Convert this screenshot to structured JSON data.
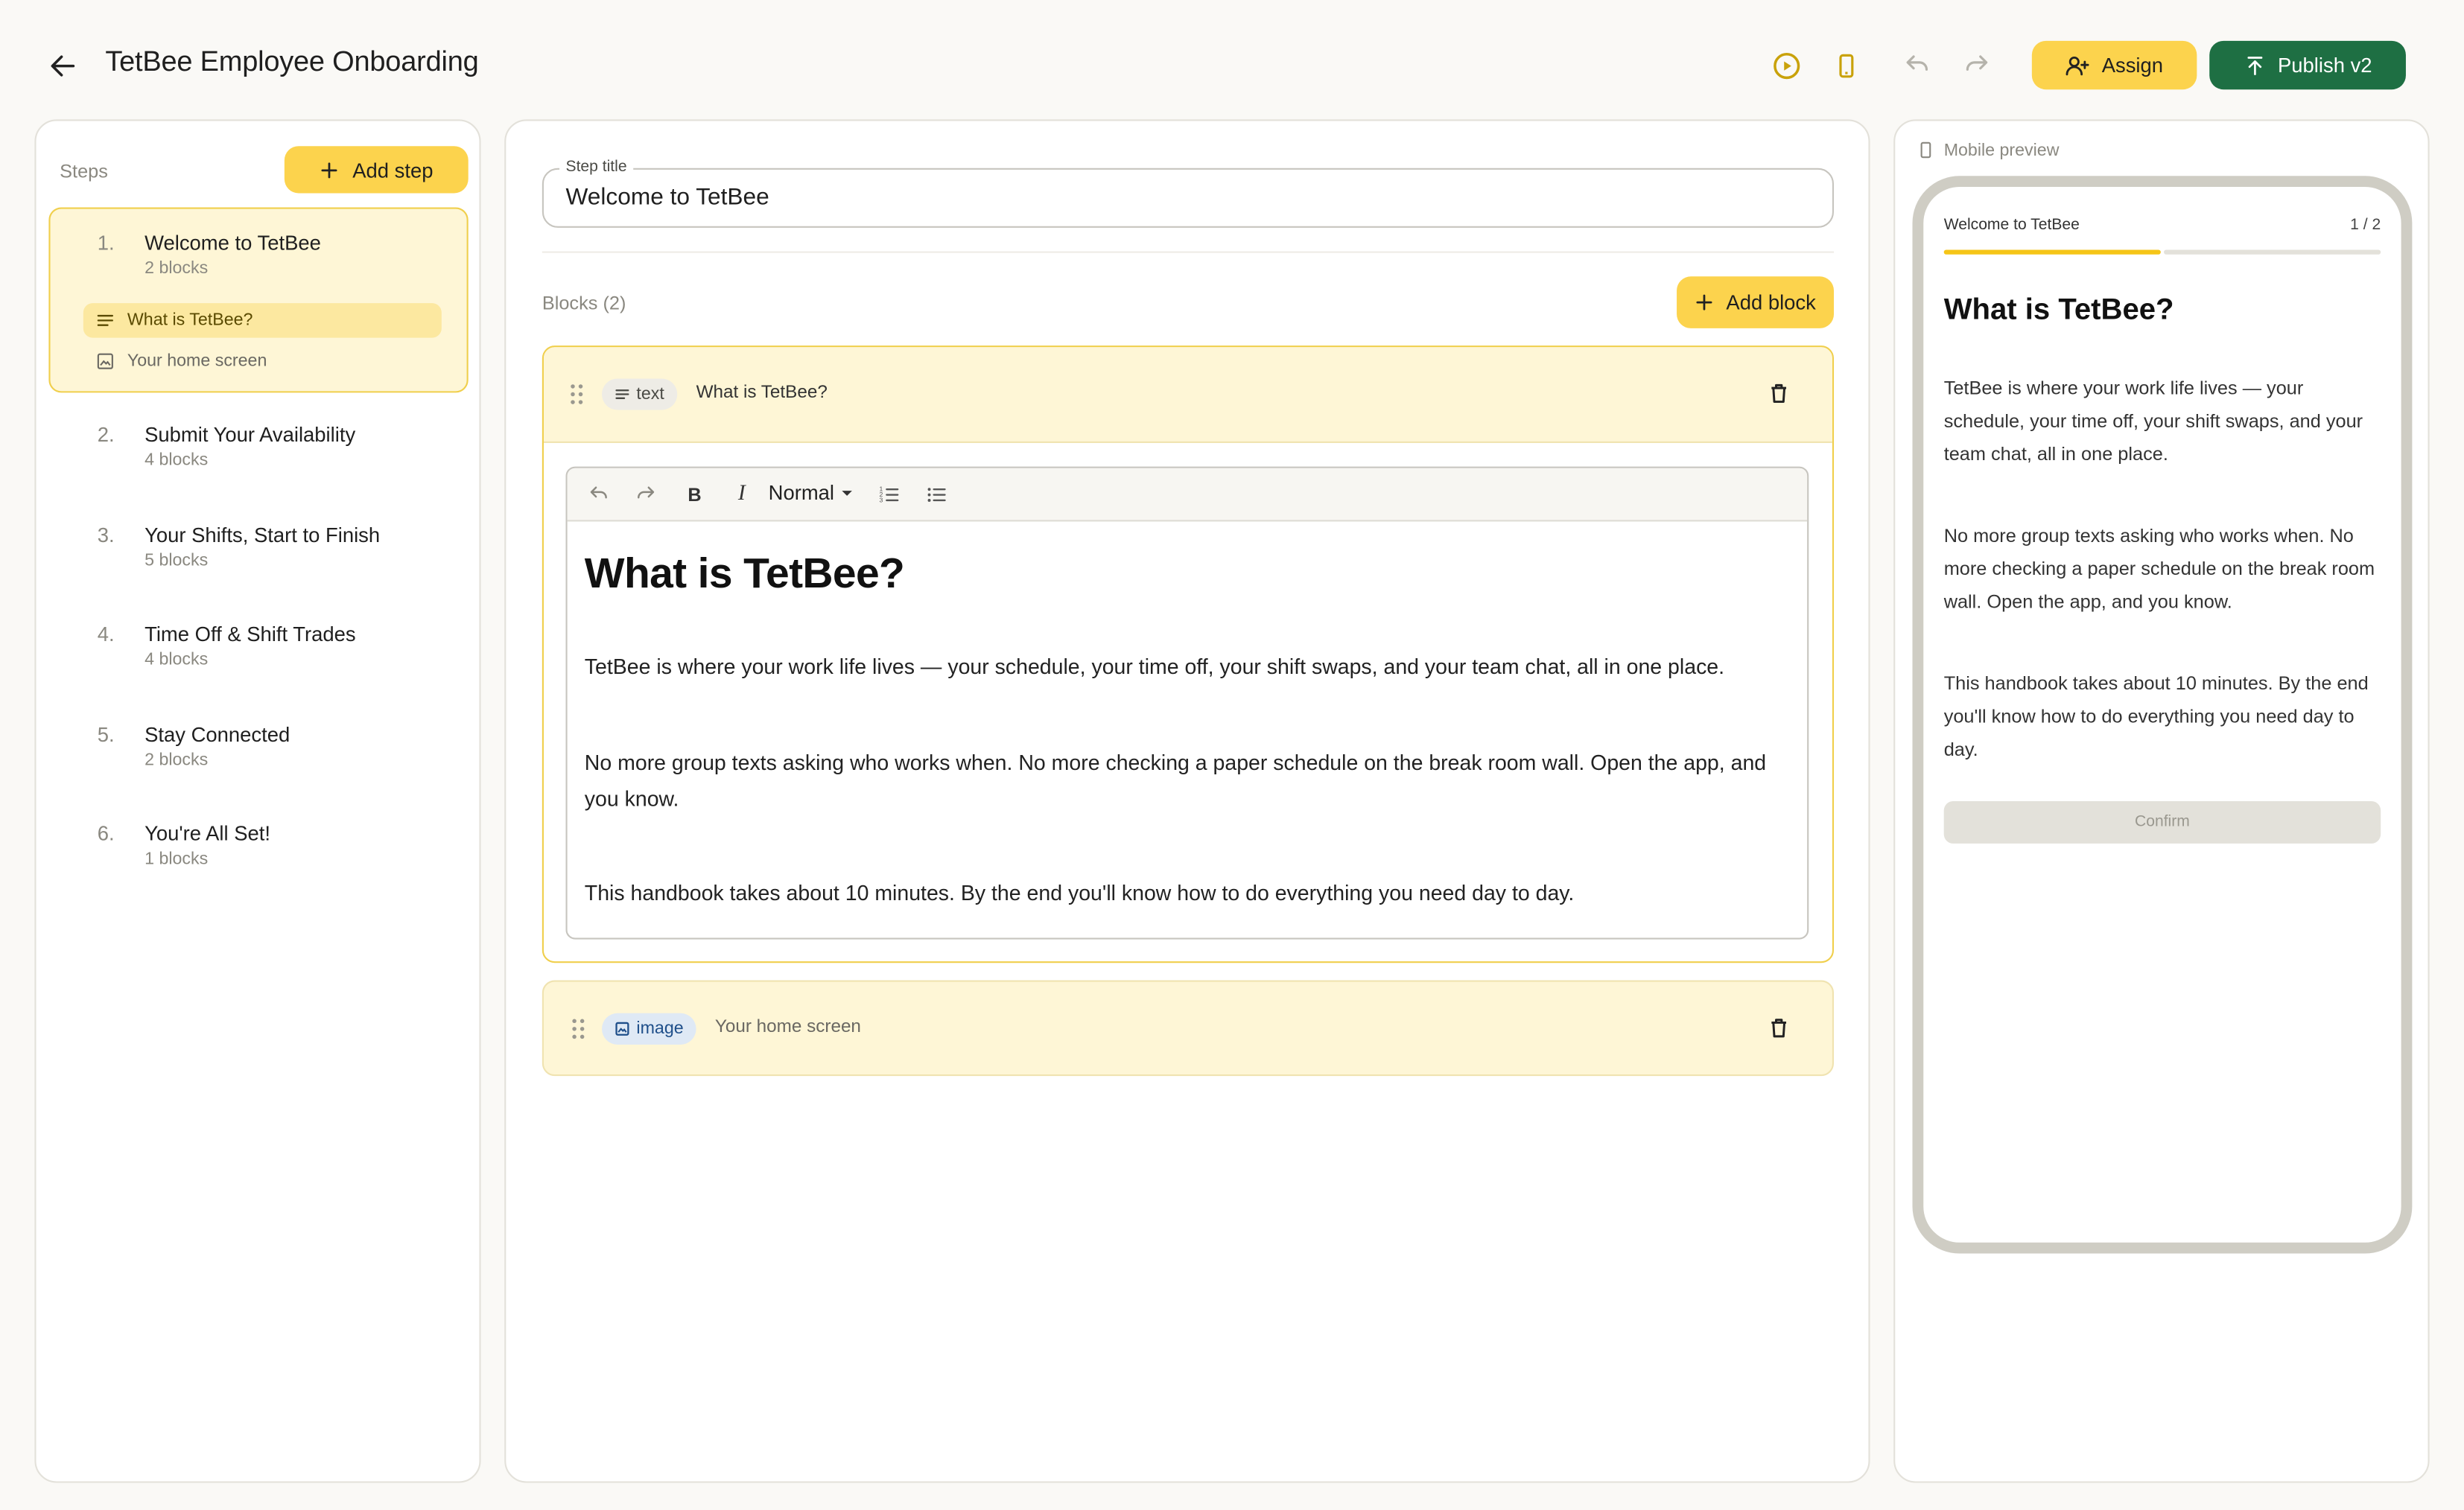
{
  "header": {
    "title": "TetBee Employee Onboarding",
    "assign_label": "Assign",
    "publish_label": "Publish v2",
    "icons": [
      "back-arrow-icon",
      "play-circle-icon",
      "mobile-phone-icon",
      "undo-icon",
      "redo-icon"
    ],
    "accent_color": "#fcd34d",
    "publish_color": "#1e6f43"
  },
  "steps_panel": {
    "label": "Steps",
    "add_step_label": "Add step",
    "steps": [
      {
        "num": "1.",
        "title": "Welcome to TetBee",
        "sub": "2 blocks",
        "blocks": [
          {
            "label": "What is TetBee?",
            "icon": "text-lines-icon"
          },
          {
            "label": "Your home screen",
            "icon": "image-icon"
          }
        ]
      },
      {
        "num": "2.",
        "title": "Submit Your Availability",
        "sub": "4 blocks"
      },
      {
        "num": "3.",
        "title": "Your Shifts, Start to Finish",
        "sub": "5 blocks"
      },
      {
        "num": "4.",
        "title": "Time Off & Shift Trades",
        "sub": "4 blocks"
      },
      {
        "num": "5.",
        "title": "Stay Connected",
        "sub": "2 blocks"
      },
      {
        "num": "6.",
        "title": "You're All Set!",
        "sub": "1 blocks"
      }
    ]
  },
  "editor": {
    "step_title_label": "Step title",
    "step_title_value": "Welcome to TetBee",
    "blocks_label": "Blocks (2)",
    "add_block_label": "Add block",
    "blocks": [
      {
        "type": "text",
        "title": "What is TetBee?"
      },
      {
        "type": "image",
        "title": "Your home screen"
      }
    ],
    "toolbar": {
      "bold": "B",
      "italic": "I",
      "style": "Normal"
    },
    "content": {
      "heading": "What is TetBee?",
      "p1": "TetBee is where your work life lives — your schedule, your time off, your shift swaps, and your team chat, all in one place.",
      "p2": "No more group texts asking who works when. No more checking a paper schedule on the break room wall. Open the app, and you know.",
      "p3": "This handbook takes about 10 minutes. By the end you'll know how to do everything you need day to day."
    }
  },
  "mobile_preview": {
    "label": "Mobile preview",
    "step_title": "Welcome to TetBee",
    "counter": "1 / 2",
    "progress": 0.5,
    "heading": "What is TetBee?",
    "p1": "TetBee is where your work life lives — your schedule, your time off, your shift swaps, and your team chat, all in one place.",
    "p2": "No more group texts asking who works when. No more checking a paper schedule on the break room wall. Open the app, and you know.",
    "p3": "This handbook takes about 10 minutes. By the end you'll know how to do everything you need day to day.",
    "confirm_label": "Confirm"
  }
}
